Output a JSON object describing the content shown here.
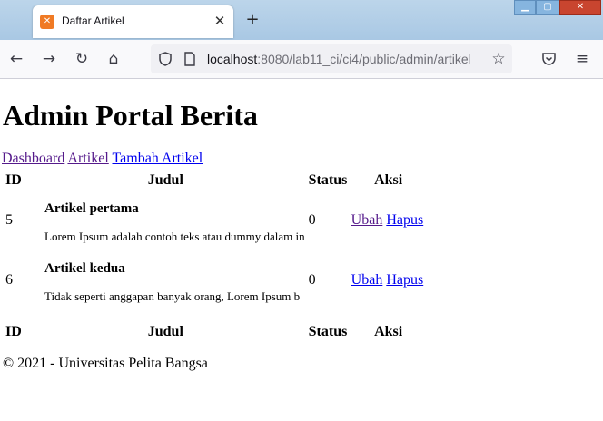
{
  "browser": {
    "tab_title": "Daftar Artikel",
    "tab_close": "✕",
    "new_tab": "+",
    "url_host": "localhost",
    "url_rest": ":8080/lab11_ci/ci4/public/admin/artikel",
    "icons": [
      "back-icon",
      "forward-icon",
      "reload-icon",
      "home-icon",
      "shield-icon",
      "page-icon",
      "star-icon",
      "pocket-icon",
      "menu-icon"
    ]
  },
  "page": {
    "title": "Admin Portal Berita",
    "nav": [
      "Dashboard",
      "Artikel",
      "Tambah Artikel"
    ],
    "table": {
      "headers": [
        "ID",
        "Judul",
        "Status",
        "Aksi"
      ],
      "rows": [
        {
          "id": "5",
          "judul": "Artikel pertama",
          "isi": "Lorem Ipsum adalah contoh teks atau dummy dalam in",
          "status": "0",
          "ubah": "Ubah",
          "hapus": "Hapus"
        },
        {
          "id": "6",
          "judul": "Artikel kedua",
          "isi": "Tidak seperti anggapan banyak orang, Lorem Ipsum b",
          "status": "0",
          "ubah": "Ubah",
          "hapus": "Hapus"
        }
      ]
    },
    "footer": "© 2021 - Universitas Pelita Bangsa"
  }
}
